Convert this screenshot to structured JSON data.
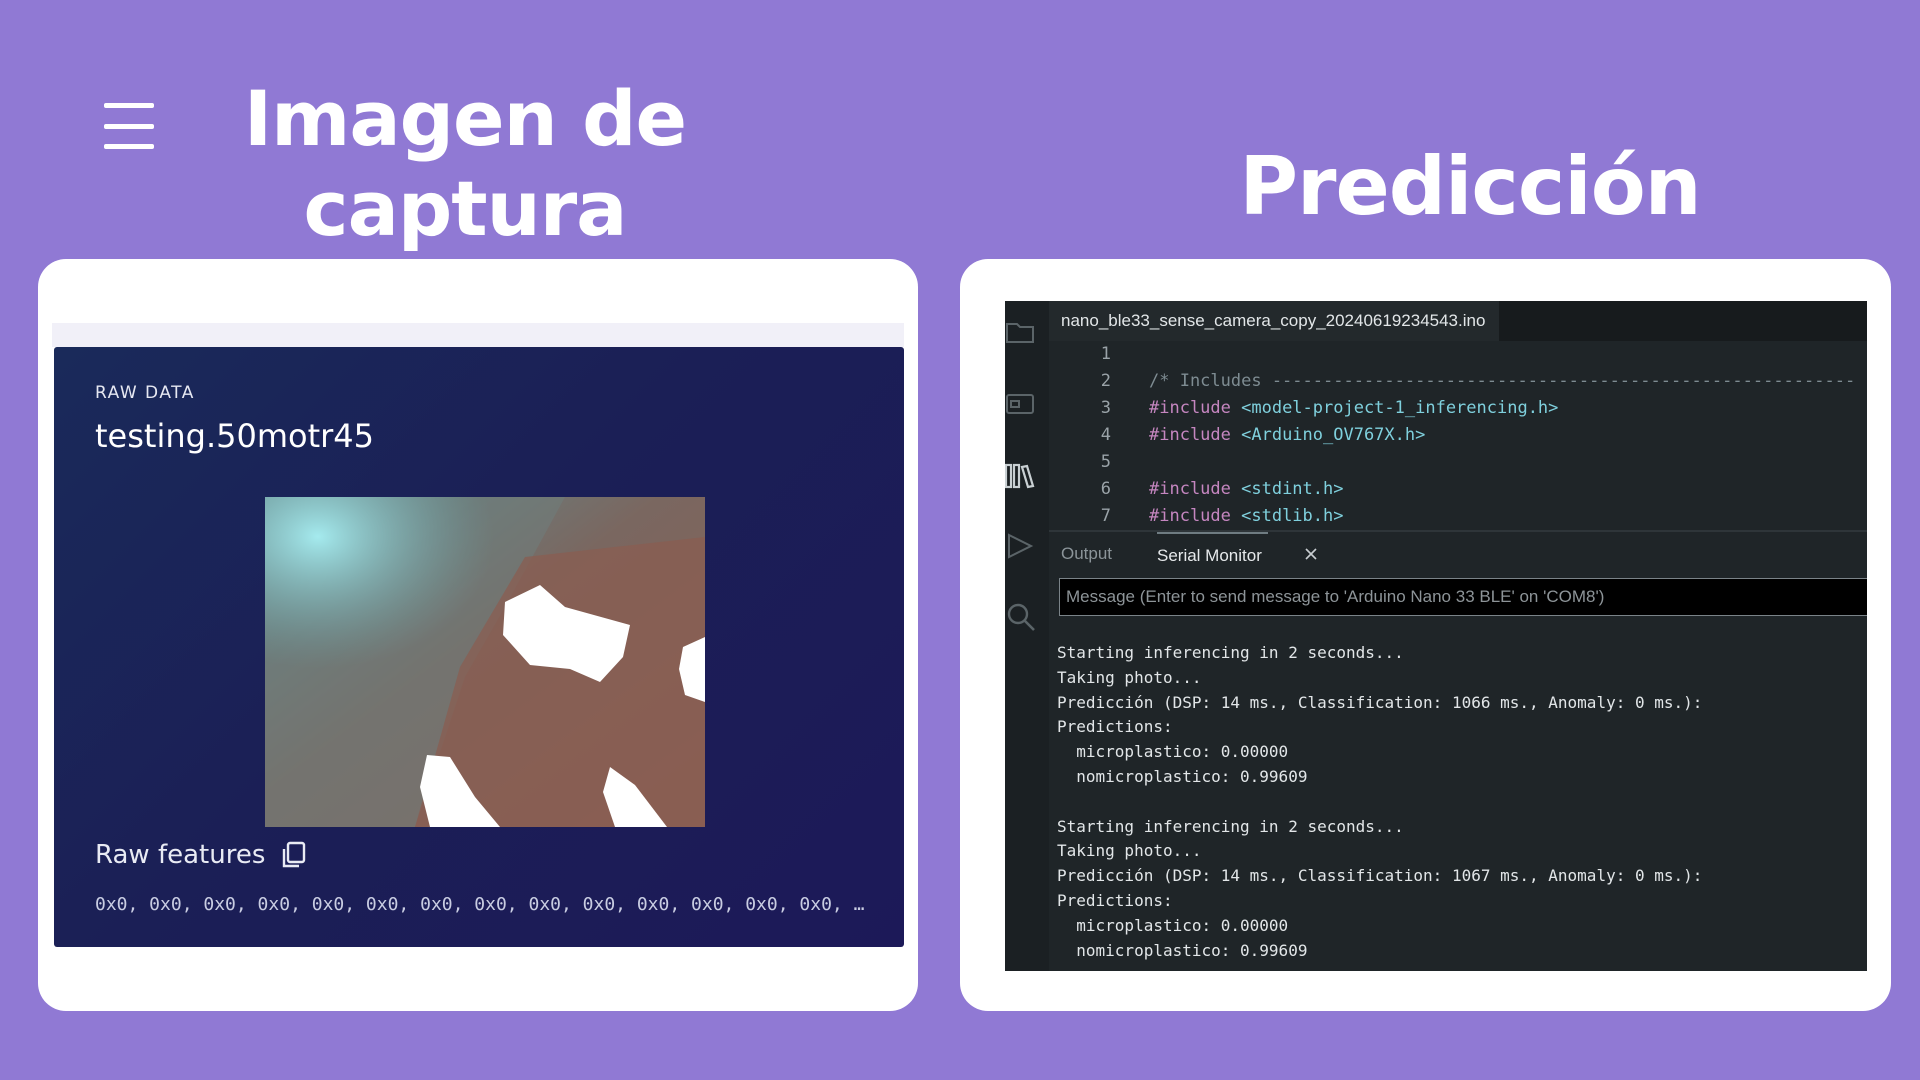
{
  "slide": {
    "left_heading": "Imagen de\ncaptura",
    "right_heading": "Predicción",
    "menu_icon": "hamburger-menu-icon"
  },
  "raw_data": {
    "section_label": "RAW DATA",
    "sample_name": "testing.50motr45",
    "features_title": "Raw features",
    "features_values": "0x0, 0x0, 0x0, 0x0, 0x0, 0x0, 0x0, 0x0, 0x0, 0x0, 0x0, 0x0, 0x0, 0x0, …",
    "copy_icon": "copy-icon"
  },
  "ide": {
    "file_tab": "nano_ble33_sense_camera_copy_20240619234543.ino",
    "code_lines": [
      {
        "n": "1",
        "text": ""
      },
      {
        "n": "2",
        "text": "/* Includes ---------------------------------------------------------"
      },
      {
        "n": "3",
        "text": "#include <model-project-1_inferencing.h>"
      },
      {
        "n": "4",
        "text": "#include <Arduino_OV767X.h>"
      },
      {
        "n": "5",
        "text": ""
      },
      {
        "n": "6",
        "text": "#include <stdint.h>"
      },
      {
        "n": "7",
        "text": "#include <stdlib.h>"
      }
    ],
    "panel_tabs": {
      "output": "Output",
      "serial_monitor": "Serial Monitor"
    },
    "serial_placeholder": "Message (Enter to send message to 'Arduino Nano 33 BLE' on 'COM8')",
    "serial_lines": [
      "Starting inferencing in 2 seconds...",
      "Taking photo...",
      "Predicción (DSP: 14 ms., Classification: 1066 ms., Anomaly: 0 ms.):",
      "Predictions:",
      "  microplastico: 0.00000",
      "  nomicroplastico: 0.99609",
      "",
      "Starting inferencing in 2 seconds...",
      "Taking photo...",
      "Predicción (DSP: 14 ms., Classification: 1067 ms., Anomaly: 0 ms.):",
      "Predictions:",
      "  microplastico: 0.00000",
      "  nomicroplastico: 0.99609"
    ],
    "activity_icons": [
      "folder-icon",
      "board-icon",
      "library-icon",
      "debug-icon",
      "search-icon"
    ]
  },
  "colors": {
    "background": "#9079d4",
    "panel_navy": "#1b1f56",
    "ide_bg": "#1f2528",
    "keyword": "#c586c0",
    "header_string": "#7fd0dd"
  }
}
